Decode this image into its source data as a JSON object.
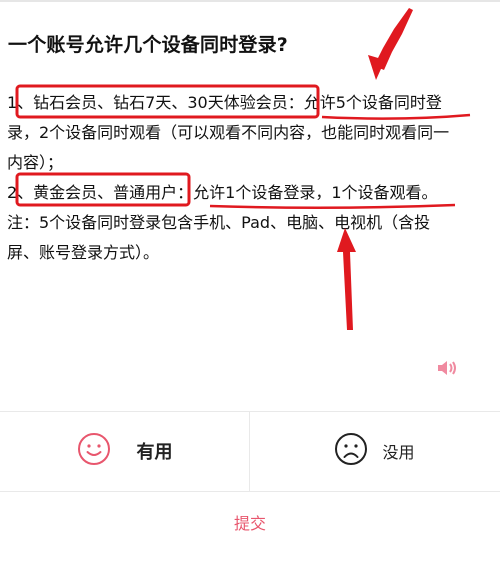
{
  "question": {
    "title": "一个账号允许几个设备同时登录?"
  },
  "answer": {
    "p1_line1": "1、钻石会员、钻石7天、30天体验会员：允许5个设备同时登",
    "p1_line2": "录，2个设备同时观看（可以观看不同内容，也能同时观看同一",
    "p1_line3": "内容）；",
    "p2": "2、黄金会员、普通用户：允许1个设备登录，1个设备观看。",
    "p3_line1": "注：5个设备同时登录包含手机、Pad、电脑、电视机（含投",
    "p3_line2": "屏、账号登录方式）。"
  },
  "audio": {
    "icon": "speaker-icon"
  },
  "feedback": {
    "useful_label": "有用",
    "useless_label": "没用",
    "useful_icon": "smile-icon",
    "useless_icon": "frown-icon",
    "submit_label": "提交"
  },
  "colors": {
    "accent": "#e8566d",
    "annotation_red": "#e0191f"
  }
}
